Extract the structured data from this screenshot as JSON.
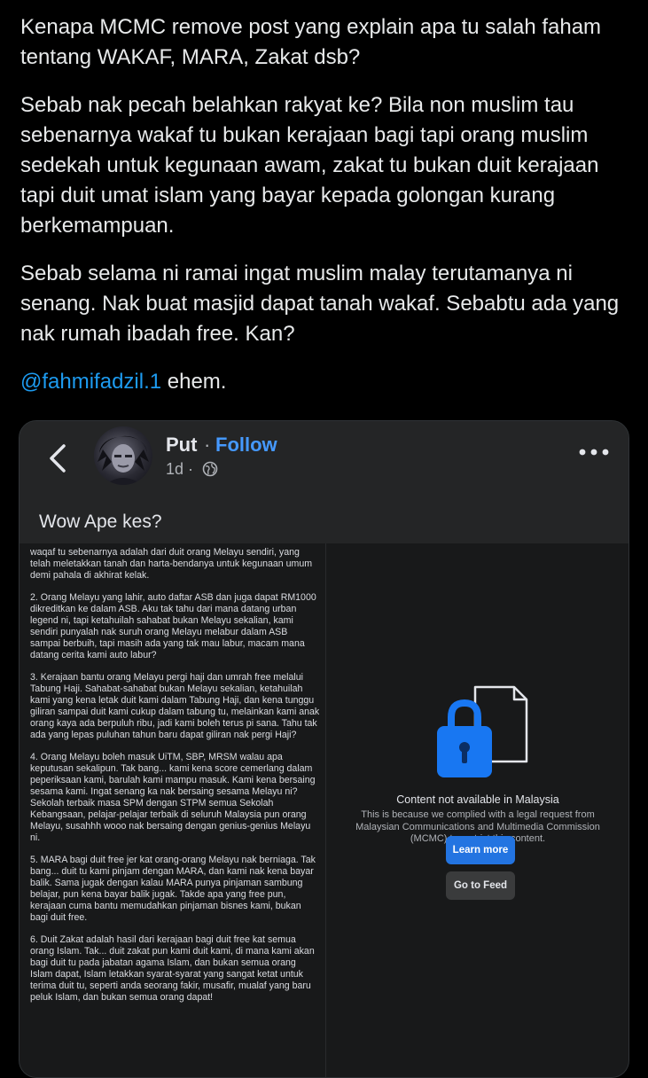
{
  "post": {
    "paragraphs": [
      "Kenapa MCMC remove post yang explain apa tu salah faham tentang WAKAF, MARA, Zakat dsb?",
      "Sebab nak pecah belahkan rakyat ke? Bila non muslim tau sebenarnya wakaf tu bukan kerajaan bagi tapi orang muslim sedekah untuk kegunaan awam, zakat tu bukan duit kerajaan tapi duit umat islam yang bayar kepada golongan kurang berkemampuan.",
      "Sebab selama ni ramai ingat muslim malay terutamanya ni senang. Nak buat masjid dapat tanah wakaf. Sebabtu ada yang nak rumah ibadah free. Kan?"
    ],
    "mention": "@fahmifadzil.1",
    "mention_suffix": " ehem."
  },
  "fb": {
    "author": "Put",
    "separator": "·",
    "follow_label": "Follow",
    "time": "1d ·",
    "caption": "Wow Ape kes?",
    "shared_text": [
      "waqaf tu sebenarnya adalah dari duit orang Melayu sendiri, yang telah meletakkan tanah dan harta-bendanya untuk kegunaan umum demi pahala di akhirat kelak.",
      "2. Orang Melayu yang lahir, auto daftar ASB dan juga dapat RM1000 dikreditkan ke dalam ASB. Aku tak tahu dari mana datang urban legend ni, tapi ketahuilah sahabat bukan Melayu sekalian, kami sendiri punyalah nak suruh orang Melayu melabur dalam ASB sampai berbuih, tapi masih ada yang tak mau labur, macam mana datang cerita kami auto labur?",
      "3. Kerajaan bantu orang Melayu pergi haji dan umrah free melalui Tabung Haji. Sahabat-sahabat bukan Melayu sekalian, ketahuilah kami yang kena letak duit kami dalam Tabung Haji, dan kena tunggu giliran sampai duit kami cukup dalam tabung tu, melainkan kami anak orang kaya ada berpuluh ribu, jadi kami boleh terus pi sana. Tahu tak ada yang lepas puluhan tahun baru dapat giliran nak pergi Haji?",
      "4. Orang Melayu boleh masuk UiTM, SBP, MRSM walau apa keputusan sekalipun. Tak bang... kami kena score cemerlang dalam peperiksaan kami, barulah kami mampu masuk. Kami kena bersaing sesama kami. Ingat senang ka nak bersaing sesama Melayu ni? Sekolah terbaik masa SPM dengan STPM semua Sekolah Kebangsaan, pelajar-pelajar terbaik di seluruh Malaysia pun orang Melayu, susahhh wooo nak bersaing dengan genius-genius Melayu ni.",
      "5. MARA bagi duit free jer kat orang-orang Melayu nak berniaga. Tak bang... duit tu kami pinjam dengan MARA, dan kami nak kena bayar balik. Sama jugak dengan kalau MARA punya pinjaman sambung belajar, pun kena bayar balik jugak. Takde apa yang free pun, kerajaan cuma bantu memudahkan pinjaman bisnes kami, bukan bagi duit free.",
      "6. Duit Zakat adalah hasil dari kerajaan bagi duit free kat semua orang Islam. Tak... duit zakat pun kami duit kami, di mana kami akan bagi duit tu pada jabatan agama Islam, dan bukan semua orang Islam dapat, Islam letakkan syarat-syarat yang sangat ketat untuk terima duit tu, seperti anda seorang fakir, musafir, mualaf yang baru peluk Islam, dan bukan semua orang dapat!"
    ],
    "notice": {
      "title": "Content not available in Malaysia",
      "body": "This is because we complied with a legal request from Malaysian Communications and Multimedia Commission (MCMC) to restrict this content.",
      "learn_more_label": "Learn more",
      "go_to_feed_label": "Go to Feed"
    }
  },
  "colors": {
    "background": "#000000",
    "text": "#e7e9ea",
    "mention": "#1d9bf0",
    "follow": "#4599ff",
    "fb_card": "#242526",
    "fb_inner": "#18191a",
    "learn_more_button": "#2374e1",
    "lock": "#1877f2"
  },
  "icons": {
    "back": "chevron-left-icon",
    "privacy": "globe-icon",
    "menu": "more-horizontal-icon",
    "notice": "lock-document-icon"
  }
}
